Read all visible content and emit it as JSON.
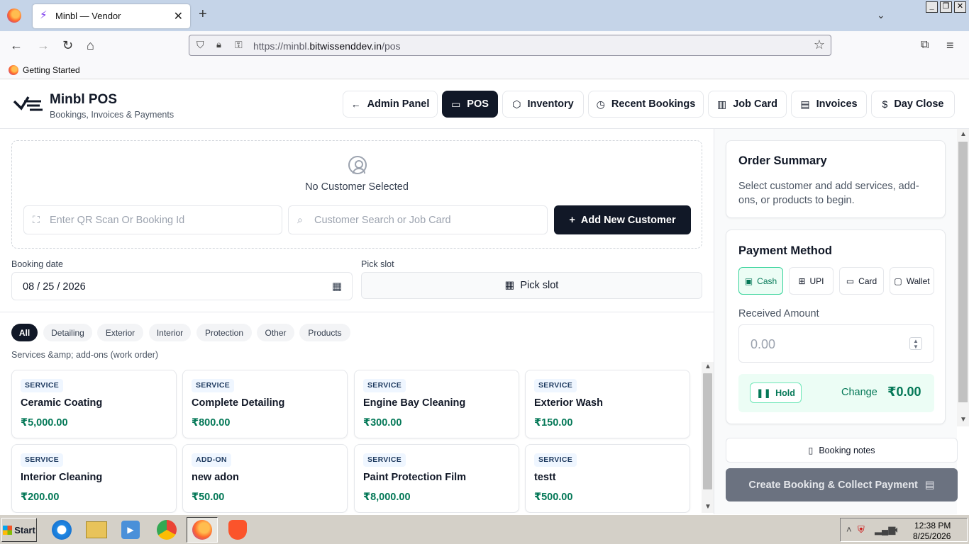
{
  "browser": {
    "tab_title": "Minbl — Vendor",
    "url_prefix": "https://minbl.",
    "url_domain": "bitwissenddev.in",
    "url_path": "/pos",
    "bookmark": "Getting Started"
  },
  "header": {
    "title": "Minbl POS",
    "subtitle": "Bookings, Invoices & Payments",
    "nav": [
      {
        "label": "Admin Panel",
        "icon": "arrow-left-icon"
      },
      {
        "label": "POS",
        "icon": "card-icon",
        "active": true
      },
      {
        "label": "Inventory",
        "icon": "box-icon"
      },
      {
        "label": "Recent Bookings",
        "icon": "clock-icon"
      },
      {
        "label": "Job Card",
        "icon": "building-icon"
      },
      {
        "label": "Invoices",
        "icon": "document-icon"
      },
      {
        "label": "Day Close",
        "icon": "dollar-icon"
      }
    ]
  },
  "customer": {
    "none_text": "No Customer Selected",
    "qr_placeholder": "Enter QR Scan Or Booking Id",
    "search_placeholder": "Customer Search or Job Card",
    "add_label": "Add New Customer"
  },
  "booking": {
    "date_label": "Booking date",
    "date_value": "08 / 25 / 2026",
    "slot_label": "Pick slot",
    "slot_button": "Pick slot"
  },
  "filters": [
    "All",
    "Detailing",
    "Exterior",
    "Interior",
    "Protection",
    "Other",
    "Products"
  ],
  "section_title": "Services &amp; add-ons (work order)",
  "items": [
    {
      "type": "SERVICE",
      "name": "Ceramic Coating",
      "price": "₹5,000.00"
    },
    {
      "type": "SERVICE",
      "name": "Complete Detailing",
      "price": "₹800.00"
    },
    {
      "type": "SERVICE",
      "name": "Engine Bay Cleaning",
      "price": "₹300.00"
    },
    {
      "type": "SERVICE",
      "name": "Exterior Wash",
      "price": "₹150.00"
    },
    {
      "type": "SERVICE",
      "name": "Interior Cleaning",
      "price": "₹200.00"
    },
    {
      "type": "ADD-ON",
      "name": "new adon",
      "price": "₹50.00"
    },
    {
      "type": "SERVICE",
      "name": "Paint Protection Film",
      "price": "₹8,000.00"
    },
    {
      "type": "SERVICE",
      "name": "testt",
      "price": "₹500.00"
    }
  ],
  "order_summary": {
    "title": "Order Summary",
    "text": "Select customer and add services, add-ons, or products to begin."
  },
  "payment": {
    "title": "Payment Method",
    "methods": [
      "Cash",
      "UPI",
      "Card",
      "Wallet"
    ],
    "selected": "Cash",
    "received_label": "Received Amount",
    "received_placeholder": "0.00",
    "hold_label": "Hold",
    "change_label": "Change",
    "change_value": "₹0.00"
  },
  "actions": {
    "notes_label": "Booking notes",
    "create_label": "Create Booking & Collect Payment"
  },
  "taskbar": {
    "start_label": "Start",
    "time": "12:38 PM",
    "date": "8/25/2026"
  }
}
